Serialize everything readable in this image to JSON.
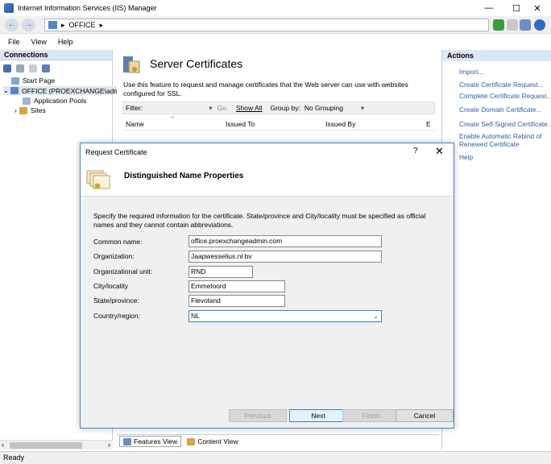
{
  "window": {
    "title": "Internet Information Services (IIS) Manager",
    "minimize": "—",
    "maximize": "☐",
    "close": "✕"
  },
  "address": {
    "back": "←",
    "forward": "→",
    "path_sep": "▸",
    "path_item": "OFFICE",
    "path_sep2": "▸"
  },
  "menu": {
    "file": "File",
    "view": "View",
    "help": "Help"
  },
  "connections": {
    "header": "Connections",
    "items": [
      {
        "label": "Start Page"
      },
      {
        "label": "OFFICE (PROEXCHANGE\\adm"
      },
      {
        "label": "Application Pools"
      },
      {
        "label": "Sites"
      }
    ],
    "expand": "⌄",
    "collapse": "›",
    "scroll_left": "‹",
    "scroll_right": "›"
  },
  "center": {
    "title": "Server Certificates",
    "description": "Use this feature to request and manage certificates that the Web server can use with websites configured for SSL.",
    "filter_label": "Filter:",
    "go_label": "Go",
    "show_all_label": "Show All",
    "group_by_label": "Group by:",
    "group_by_value": "No Grouping",
    "columns": [
      "Name",
      "Issued To",
      "Issued By",
      "E"
    ],
    "sort_arrow": "^",
    "tab_features": "Features View",
    "tab_content": "Content View"
  },
  "actions": {
    "header": "Actions",
    "items": [
      "Import...",
      "Create Certificate Request...",
      "Complete Certificate Request...",
      "Create Domain Certificate...",
      "Create Self-Signed Certificate...",
      "Enable Automatic Rebind of",
      "Renewed Certificate",
      "Help"
    ]
  },
  "dialog": {
    "title": "Request Certificate",
    "help": "?",
    "close": "✕",
    "heading": "Distinguished Name Properties",
    "instructions": "Specify the required information for the certificate. State/province and City/locality must be specified as official names and they cannot contain abbreviations.",
    "fields": [
      {
        "label": "Common name:",
        "value": "office.proexchangeadmin.com"
      },
      {
        "label": "Organization:",
        "value": "Jaapwesselius.nl bv"
      },
      {
        "label": "Organizational unit:",
        "value": "RND"
      },
      {
        "label": "City/locality",
        "value": "Emmeloord"
      },
      {
        "label": "State/province:",
        "value": "Flevoland"
      },
      {
        "label": "Country/region:",
        "value": "NL"
      }
    ],
    "buttons": {
      "previous": "Previous",
      "next": "Next",
      "finish": "Finish",
      "cancel": "Cancel"
    }
  },
  "status": {
    "text": "Ready"
  }
}
